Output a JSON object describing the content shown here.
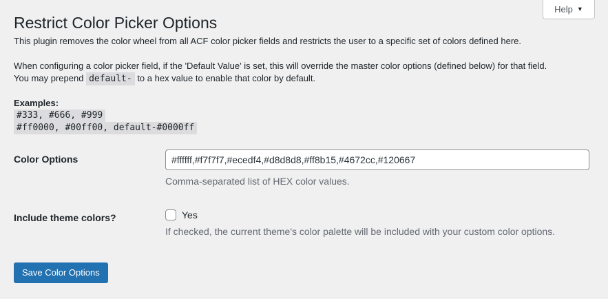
{
  "help_tab": {
    "label": "Help",
    "caret": "▼"
  },
  "page": {
    "title": "Restrict Color Picker Options",
    "intro": "This plugin removes the color wheel from all ACF color picker fields and restricts the user to a specific set of colors defined here.",
    "default_note_line1": "When configuring a color picker field, if the 'Default Value' is set, this will override the master color options (defined below) for that field.",
    "default_note_line2_before": "You may prepend",
    "default_note_line2_code": "default-",
    "default_note_line2_after": "to a hex value to enable that color by default.",
    "examples_label": "Examples:",
    "examples": [
      "#333, #666, #999",
      "#ff0000, #00ff00, default-#0000ff"
    ]
  },
  "form": {
    "color_options": {
      "label": "Color Options",
      "value": "#ffffff,#f7f7f7,#ecedf4,#d8d8d8,#ff8b15,#4672cc,#120667",
      "description": "Comma-separated list of HEX color values."
    },
    "theme_colors": {
      "label": "Include theme colors?",
      "checkbox_label": "Yes",
      "checked": false,
      "description": "If checked, the current theme's color palette will be included with your custom color options."
    },
    "save_label": "Save Color Options"
  },
  "colors": {
    "accent": "#2271b1",
    "background": "#f0f0f1",
    "text": "#1d2327",
    "description_text": "#646970",
    "code_background": "#dcdcde"
  }
}
